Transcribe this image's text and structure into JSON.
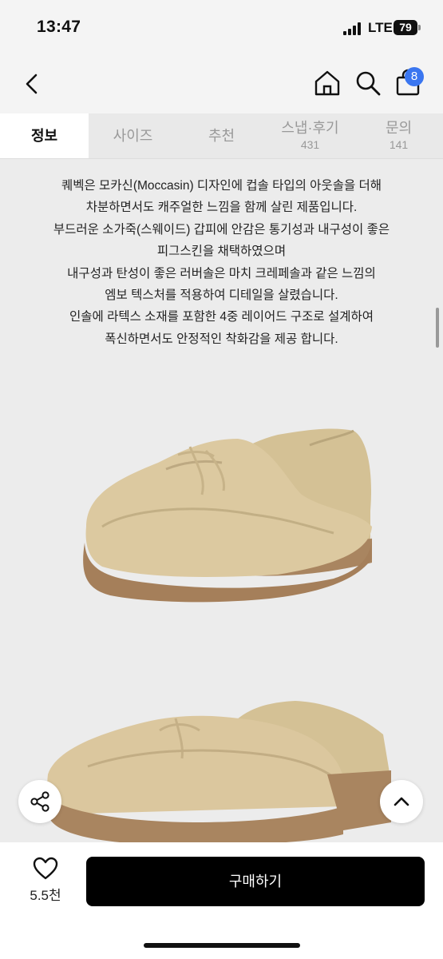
{
  "status": {
    "time": "13:47",
    "network": "LTE",
    "battery": "79"
  },
  "header": {
    "cart_count": "8"
  },
  "tabs": [
    {
      "label": "정보"
    },
    {
      "label": "사이즈"
    },
    {
      "label": "추천"
    },
    {
      "label": "스냅·후기",
      "count": "431"
    },
    {
      "label": "문의",
      "count": "141"
    }
  ],
  "description": [
    "퀘벡은 모카신(Moccasin) 디자인에 컵솔 타입의 아웃솔을 더해",
    "차분하면서도 캐주얼한 느낌을 함께 살린 제품입니다.",
    "부드러운 소가죽(스웨이드) 갑피에 안감은 통기성과 내구성이 좋은",
    "피그스킨을 채택하였으며",
    "내구성과 탄성이 좋은 러버솔은 마치 크레페솔과 같은 느낌의",
    "엠보 텍스처를 적용하여 디테일을 살렸습니다.",
    "인솔에 라텍스 소재를 포함한 4중 레이어드 구조로 설계하여",
    "폭신하면서도 안정적인 착화감을 제공 합니다."
  ],
  "bottom": {
    "like_count": "5.5천",
    "buy_label": "구매하기"
  },
  "colors": {
    "accent": "#3a76f0",
    "suede": "#d9c79f",
    "sole": "#a7825e"
  }
}
